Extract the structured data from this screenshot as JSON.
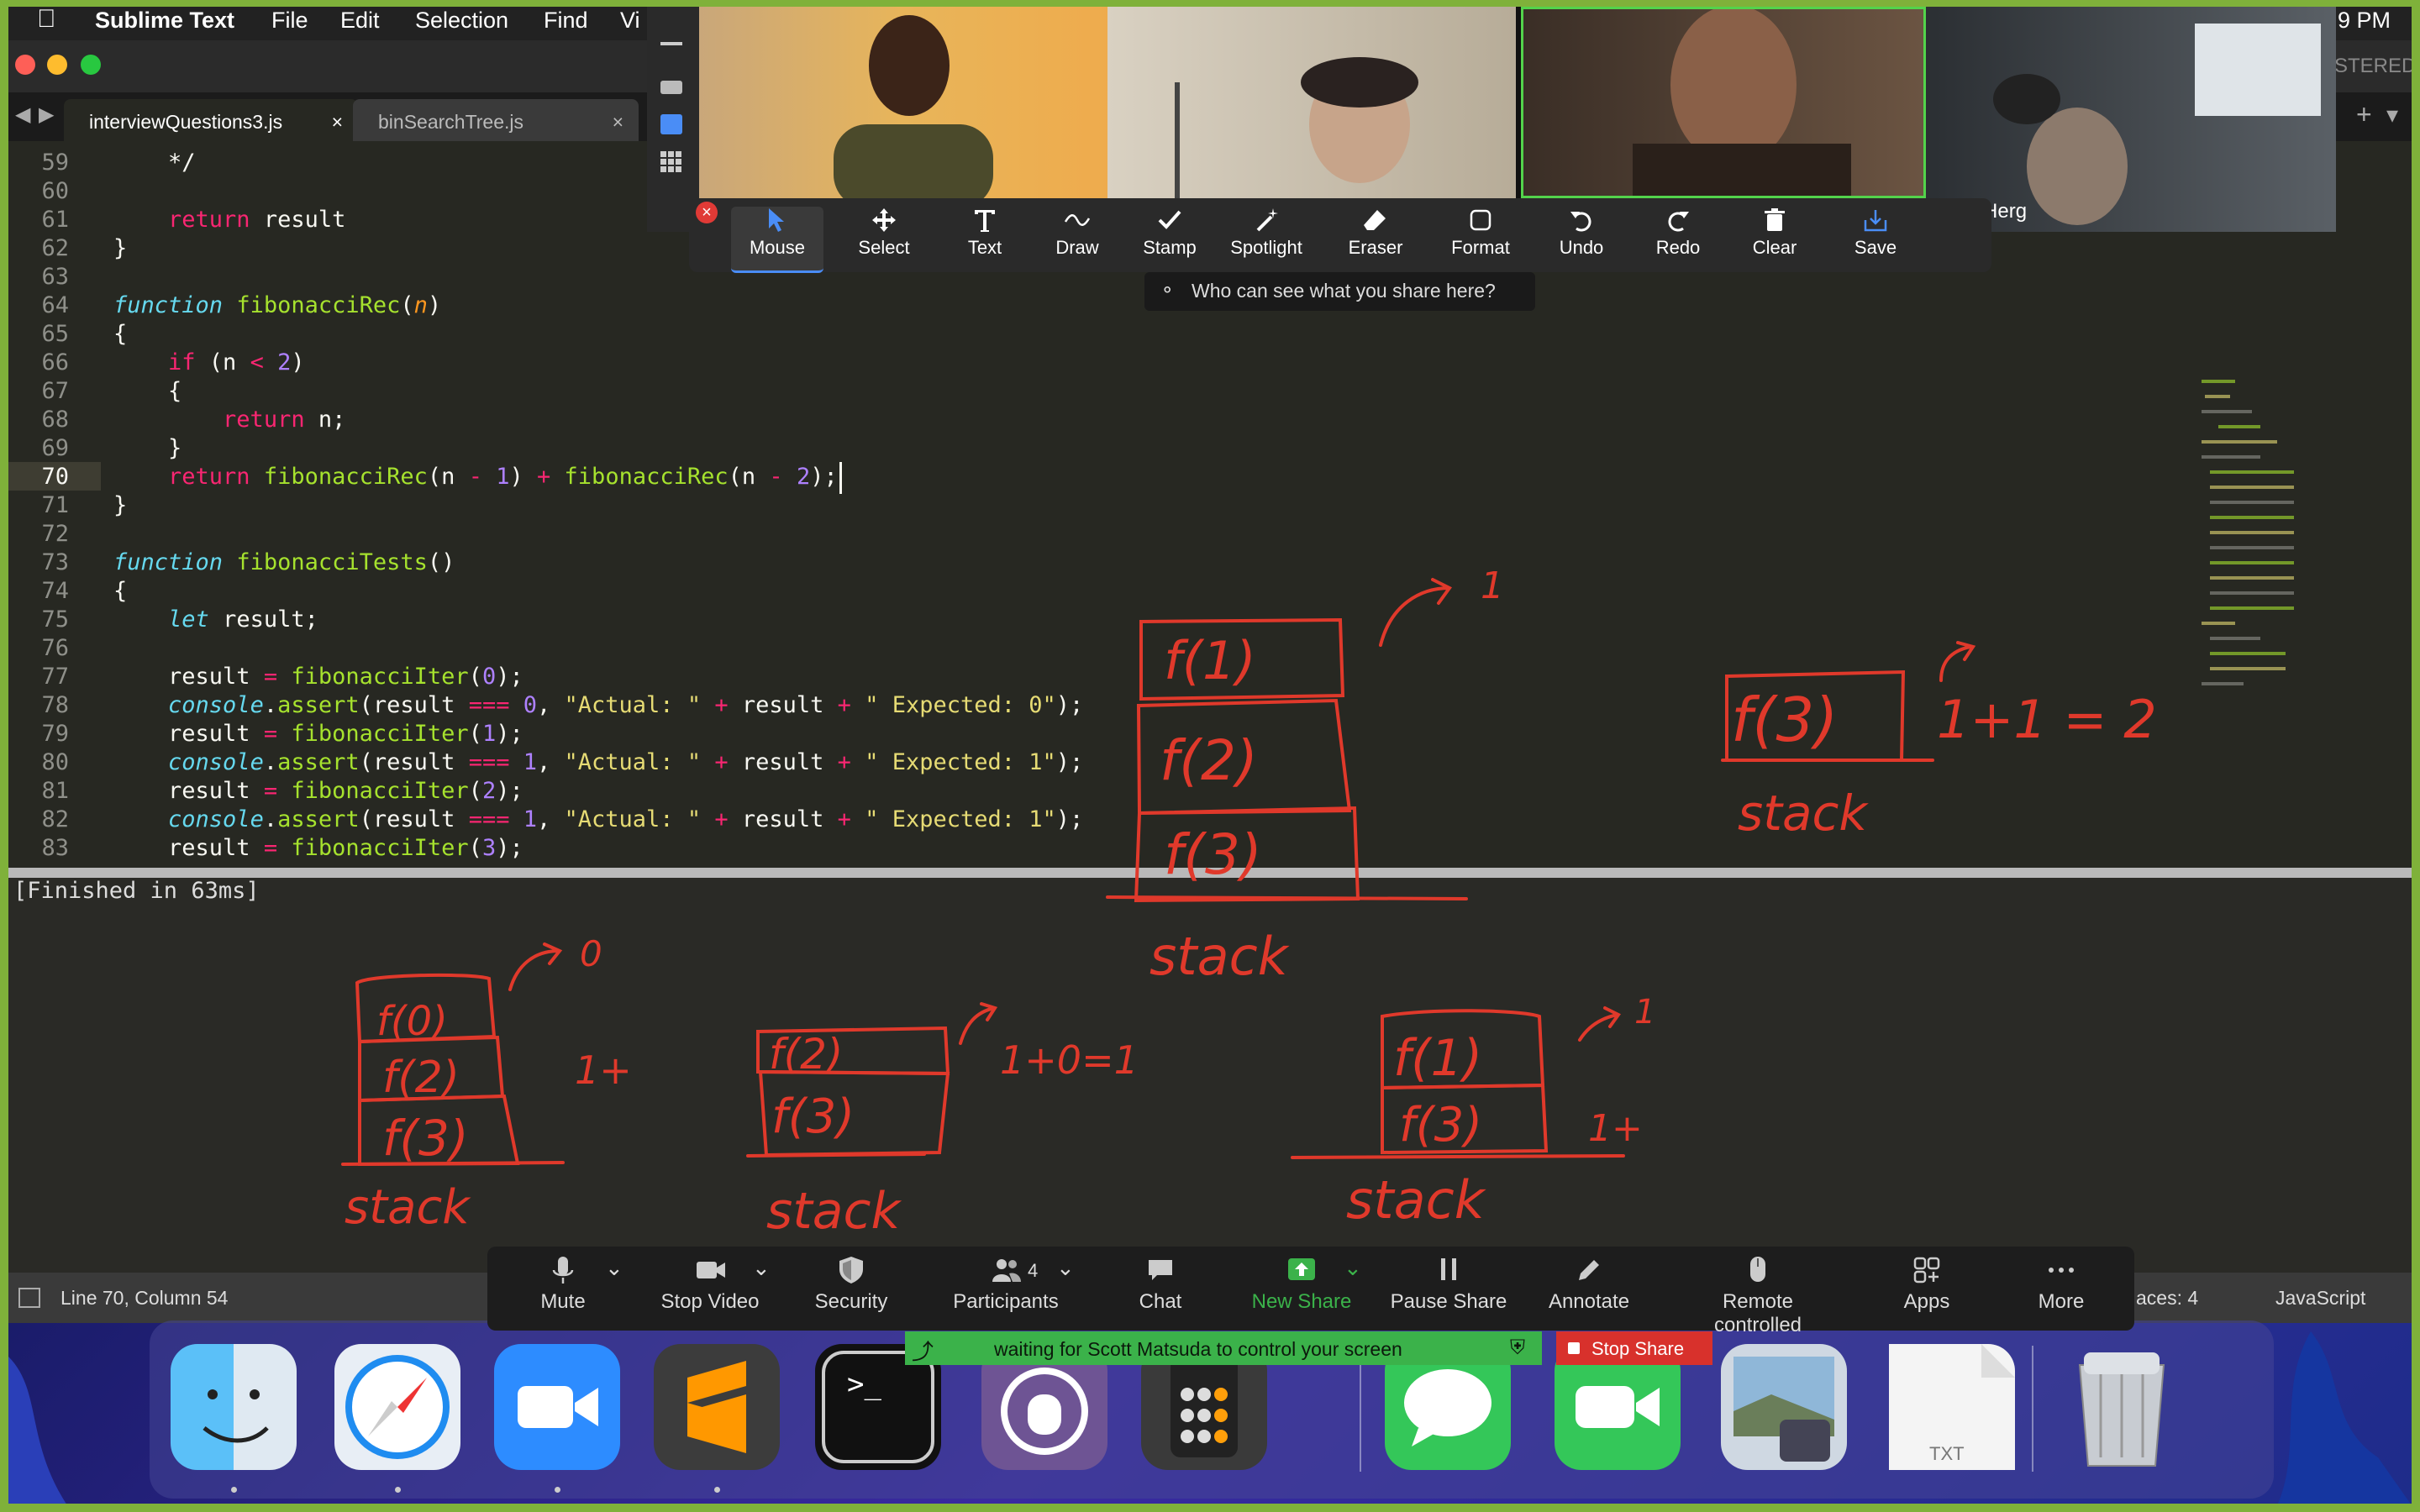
{
  "menubar": {
    "app": "Sublime Text",
    "items": [
      "File",
      "Edit",
      "Selection",
      "Find",
      "Vi"
    ],
    "clock": "9 PM"
  },
  "titlebar": {
    "right_text": "STERED"
  },
  "tabs": [
    {
      "label": "interviewQuestions3.js",
      "active": true,
      "close": "×"
    },
    {
      "label": "binSearchTree.js",
      "active": false,
      "close": "×"
    }
  ],
  "tabbar_right": {
    "plus": "+",
    "chevron": "▾"
  },
  "editor": {
    "lines": [
      {
        "num": "59",
        "code": [
          [
            "",
            "    */"
          ]
        ]
      },
      {
        "num": "60",
        "code": []
      },
      {
        "num": "61",
        "code": [
          [
            "",
            "    "
          ],
          [
            "k",
            "return"
          ],
          [
            "",
            " result"
          ]
        ]
      },
      {
        "num": "62",
        "code": [
          [
            "",
            "}"
          ]
        ]
      },
      {
        "num": "63",
        "code": []
      },
      {
        "num": "64",
        "code": [
          [
            "i",
            "function"
          ],
          [
            "",
            " "
          ],
          [
            "f",
            "fibonacciRec"
          ],
          [
            "",
            "("
          ],
          [
            "p",
            "n"
          ],
          [
            "",
            ")"
          ]
        ]
      },
      {
        "num": "65",
        "code": [
          [
            "",
            "{"
          ]
        ]
      },
      {
        "num": "66",
        "code": [
          [
            "",
            "    "
          ],
          [
            "k",
            "if"
          ],
          [
            "",
            " (n "
          ],
          [
            "k",
            "<"
          ],
          [
            "",
            " "
          ],
          [
            "n",
            "2"
          ],
          [
            "",
            ")"
          ]
        ]
      },
      {
        "num": "67",
        "code": [
          [
            "",
            "    {"
          ]
        ]
      },
      {
        "num": "68",
        "code": [
          [
            "",
            "        "
          ],
          [
            "k",
            "return"
          ],
          [
            "",
            " n;"
          ]
        ]
      },
      {
        "num": "69",
        "code": [
          [
            "",
            "    }"
          ]
        ]
      },
      {
        "num": "70",
        "code": [
          [
            "",
            "    "
          ],
          [
            "k",
            "return"
          ],
          [
            "",
            " "
          ],
          [
            "f",
            "fibonacciRec"
          ],
          [
            "",
            "(n "
          ],
          [
            "k",
            "-"
          ],
          [
            "",
            " "
          ],
          [
            "n",
            "1"
          ],
          [
            "",
            ") "
          ],
          [
            "k",
            "+"
          ],
          [
            "",
            " "
          ],
          [
            "f",
            "fibonacciRec"
          ],
          [
            "",
            "(n "
          ],
          [
            "k",
            "-"
          ],
          [
            "",
            " "
          ],
          [
            "n",
            "2"
          ],
          [
            "",
            ");"
          ]
        ]
      },
      {
        "num": "71",
        "code": [
          [
            "",
            "}"
          ]
        ]
      },
      {
        "num": "72",
        "code": []
      },
      {
        "num": "73",
        "code": [
          [
            "i",
            "function"
          ],
          [
            "",
            " "
          ],
          [
            "f",
            "fibonacciTests"
          ],
          [
            "",
            "()"
          ]
        ]
      },
      {
        "num": "74",
        "code": [
          [
            "",
            "{"
          ]
        ]
      },
      {
        "num": "75",
        "code": [
          [
            "",
            "    "
          ],
          [
            "i",
            "let"
          ],
          [
            "",
            " result;"
          ]
        ]
      },
      {
        "num": "76",
        "code": []
      },
      {
        "num": "77",
        "code": [
          [
            "",
            "    result "
          ],
          [
            "k",
            "="
          ],
          [
            "",
            " "
          ],
          [
            "f",
            "fibonacciIter"
          ],
          [
            "",
            "("
          ],
          [
            "n",
            "0"
          ],
          [
            "",
            ");"
          ]
        ]
      },
      {
        "num": "78",
        "code": [
          [
            "",
            "    "
          ],
          [
            "i",
            "console"
          ],
          [
            "",
            "."
          ],
          [
            "f",
            "assert"
          ],
          [
            "",
            "(result "
          ],
          [
            "k",
            "==="
          ],
          [
            "",
            " "
          ],
          [
            "n",
            "0"
          ],
          [
            "",
            ", "
          ],
          [
            "s",
            "\"Actual: \""
          ],
          [
            "",
            " "
          ],
          [
            "k",
            "+"
          ],
          [
            "",
            " result "
          ],
          [
            "k",
            "+"
          ],
          [
            "",
            " "
          ],
          [
            "s",
            "\" Expected: 0\""
          ],
          [
            "",
            ");"
          ]
        ]
      },
      {
        "num": "79",
        "code": [
          [
            "",
            "    result "
          ],
          [
            "k",
            "="
          ],
          [
            "",
            " "
          ],
          [
            "f",
            "fibonacciIter"
          ],
          [
            "",
            "("
          ],
          [
            "n",
            "1"
          ],
          [
            "",
            ");"
          ]
        ]
      },
      {
        "num": "80",
        "code": [
          [
            "",
            "    "
          ],
          [
            "i",
            "console"
          ],
          [
            "",
            "."
          ],
          [
            "f",
            "assert"
          ],
          [
            "",
            "(result "
          ],
          [
            "k",
            "==="
          ],
          [
            "",
            " "
          ],
          [
            "n",
            "1"
          ],
          [
            "",
            ", "
          ],
          [
            "s",
            "\"Actual: \""
          ],
          [
            "",
            " "
          ],
          [
            "k",
            "+"
          ],
          [
            "",
            " result "
          ],
          [
            "k",
            "+"
          ],
          [
            "",
            " "
          ],
          [
            "s",
            "\" Expected: 1\""
          ],
          [
            "",
            ");"
          ]
        ]
      },
      {
        "num": "81",
        "code": [
          [
            "",
            "    result "
          ],
          [
            "k",
            "="
          ],
          [
            "",
            " "
          ],
          [
            "f",
            "fibonacciIter"
          ],
          [
            "",
            "("
          ],
          [
            "n",
            "2"
          ],
          [
            "",
            ");"
          ]
        ]
      },
      {
        "num": "82",
        "code": [
          [
            "",
            "    "
          ],
          [
            "i",
            "console"
          ],
          [
            "",
            "."
          ],
          [
            "f",
            "assert"
          ],
          [
            "",
            "(result "
          ],
          [
            "k",
            "==="
          ],
          [
            "",
            " "
          ],
          [
            "n",
            "1"
          ],
          [
            "",
            ", "
          ],
          [
            "s",
            "\"Actual: \""
          ],
          [
            "",
            " "
          ],
          [
            "k",
            "+"
          ],
          [
            "",
            " result "
          ],
          [
            "k",
            "+"
          ],
          [
            "",
            " "
          ],
          [
            "s",
            "\" Expected: 1\""
          ],
          [
            "",
            ");"
          ]
        ]
      },
      {
        "num": "83",
        "code": [
          [
            "",
            "    result "
          ],
          [
            "k",
            "="
          ],
          [
            "",
            " "
          ],
          [
            "f",
            "fibonacciIter"
          ],
          [
            "",
            "("
          ],
          [
            "n",
            "3"
          ],
          [
            "",
            ");"
          ]
        ]
      }
    ],
    "current_line": "70"
  },
  "output": {
    "text": "[Finished in 63ms]"
  },
  "status": {
    "position": "Line 70, Column 54",
    "spaces": "aces: 4",
    "syntax": "JavaScript"
  },
  "zoom": {
    "participant_tag": "n Herg",
    "annotate_tools": [
      {
        "label": "Mouse",
        "icon": "cursor-arrow-icon",
        "active": true
      },
      {
        "label": "Select",
        "icon": "move-arrows-icon"
      },
      {
        "label": "Text",
        "icon": "text-t-icon"
      },
      {
        "label": "Draw",
        "icon": "squiggle-icon"
      },
      {
        "label": "Stamp",
        "icon": "checkmark-icon"
      },
      {
        "label": "Spotlight",
        "icon": "magic-wand-icon"
      },
      {
        "label": "Eraser",
        "icon": "eraser-icon"
      },
      {
        "label": "Format",
        "icon": "square-format-icon"
      },
      {
        "label": "Undo",
        "icon": "undo-icon"
      },
      {
        "label": "Redo",
        "icon": "redo-icon"
      },
      {
        "label": "Clear",
        "icon": "trash-icon"
      },
      {
        "label": "Save",
        "icon": "save-download-icon"
      }
    ],
    "share_hint": "Who can see what you share here?",
    "controls": [
      {
        "label": "Mute",
        "icon": "microphone-icon"
      },
      {
        "label": "Stop Video",
        "icon": "video-camera-icon"
      },
      {
        "label": "Security",
        "icon": "shield-icon"
      },
      {
        "label": "Participants",
        "icon": "people-icon",
        "count": "4"
      },
      {
        "label": "Chat",
        "icon": "chat-bubble-icon"
      },
      {
        "label": "New Share",
        "icon": "share-up-arrow-icon"
      },
      {
        "label": "Pause Share",
        "icon": "pause-icon"
      },
      {
        "label": "Annotate",
        "icon": "pencil-icon"
      },
      {
        "label": "Remote controlled",
        "icon": "mouse-icon"
      },
      {
        "label": "Apps",
        "icon": "apps-icon"
      },
      {
        "label": "More",
        "icon": "ellipsis-icon"
      }
    ],
    "banner": "waiting for Scott Matsuda to control your screen",
    "stop_share": "Stop Share",
    "accent": "#3bb24a",
    "stop_color": "#d8312c"
  },
  "whiteboard": {
    "ink_color": "#e0392b",
    "labels": [
      "f(1)",
      "f(2)",
      "f(3)",
      "f(0)",
      "f(2)",
      "f(3)",
      "f(2)",
      "f(3)",
      "f(1)",
      "f(3)",
      "f(3)",
      "1",
      "1+1 = 2",
      "0",
      "1+",
      "1+0=1",
      "1",
      "1+",
      "stack",
      "stack",
      "stack",
      "stack",
      "stack"
    ]
  },
  "dock": {
    "apps": [
      {
        "name": "Finder",
        "icon": "finder-icon"
      },
      {
        "name": "Safari",
        "icon": "safari-compass-icon"
      },
      {
        "name": "Zoom",
        "icon": "zoom-camera-icon"
      },
      {
        "name": "Sublime Text",
        "icon": "sublime-s-icon"
      },
      {
        "name": "Terminal",
        "icon": "terminal-prompt-icon",
        "glyph": ">_"
      },
      {
        "name": "GitHub Desktop",
        "icon": "github-cat-icon"
      },
      {
        "name": "Calculator",
        "icon": "calculator-icon"
      },
      {
        "name": "Messages",
        "icon": "messages-bubble-icon"
      },
      {
        "name": "FaceTime",
        "icon": "facetime-camera-icon"
      },
      {
        "name": "Preview",
        "icon": "preview-photo-icon"
      },
      {
        "name": "TXT",
        "icon": "txt-document-icon",
        "glyph": "TXT"
      },
      {
        "name": "Trash",
        "icon": "trash-can-icon"
      }
    ]
  }
}
